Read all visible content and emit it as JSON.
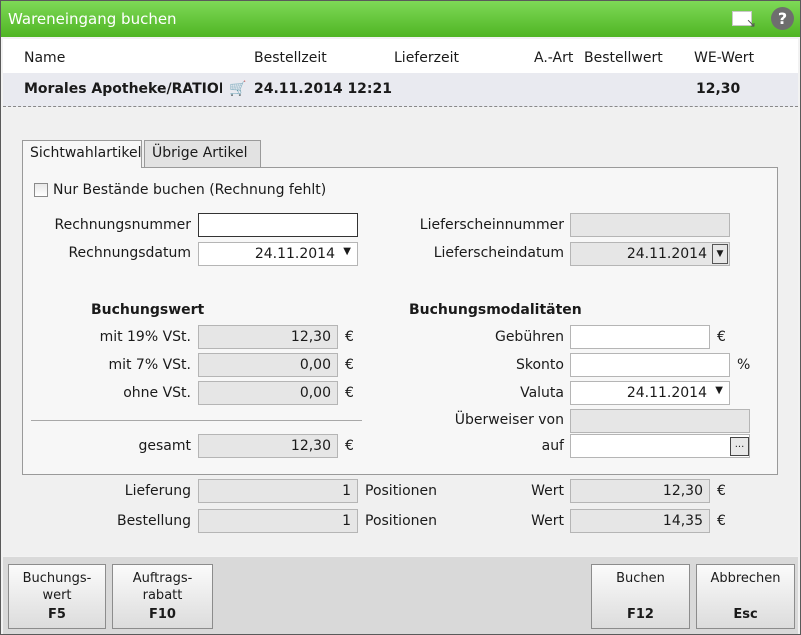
{
  "window": {
    "title": "Wareneingang buchen"
  },
  "columns": {
    "name": "Name",
    "bestellzeit": "Bestellzeit",
    "lieferzeit": "Lieferzeit",
    "aart": "A.-Art",
    "bestellwert": "Bestellwert",
    "wewert": "WE-Wert"
  },
  "order": {
    "name": "Morales Apotheke/RATIOPH",
    "bestellzeit": "24.11.2014 12:21",
    "wewert": "12,30"
  },
  "tabs": [
    "Sichtwahlartikel",
    "Übrige Artikel"
  ],
  "form": {
    "checkbox_label": "Nur Bestände buchen (Rechnung fehlt)",
    "rechnungsnummer_label": "Rechnungsnummer",
    "rechnungsnummer_value": "",
    "rechnungsdatum_label": "Rechnungsdatum",
    "rechnungsdatum_value": "24.11.2014",
    "lieferscheinnummer_label": "Lieferscheinnummer",
    "lieferscheinnummer_value": "",
    "lieferscheindatum_label": "Lieferscheindatum",
    "lieferscheindatum_value": "24.11.2014",
    "buchungswert_heading": "Buchungswert",
    "vst19_label": "mit 19% VSt.",
    "vst19_value": "12,30",
    "vst7_label": "mit 7% VSt.",
    "vst7_value": "0,00",
    "ohne_label": "ohne VSt.",
    "ohne_value": "0,00",
    "gesamt_label": "gesamt",
    "gesamt_value": "12,30",
    "currency": "€",
    "percent": "%",
    "modalitaeten_heading": "Buchungsmodalitäten",
    "gebuehren_label": "Gebühren",
    "gebuehren_value": "",
    "skonto_label": "Skonto",
    "skonto_value": "",
    "valuta_label": "Valuta",
    "valuta_value": "24.11.2014",
    "ueberweiser_label": "Überweiser von",
    "ueberweiser_value": "",
    "auf_label": "auf",
    "auf_value": "",
    "ellipsis": "..."
  },
  "summary": {
    "lieferung_label": "Lieferung",
    "lieferung_count": "1",
    "bestellung_label": "Bestellung",
    "bestellung_count": "1",
    "positionen": "Positionen",
    "wert_label": "Wert",
    "lieferung_wert": "12,30",
    "bestellung_wert": "14,35"
  },
  "footer": {
    "buchungswert": {
      "line1": "Buchungs-",
      "line2": "wert",
      "key": "F5"
    },
    "auftragsrabatt": {
      "line1": "Auftrags-",
      "line2": "rabatt",
      "key": "F10"
    },
    "buchen": {
      "line1": "Buchen",
      "key": "F12"
    },
    "abbrechen": {
      "line1": "Abbrechen",
      "key": "Esc"
    }
  },
  "colors": {
    "titlebar": "#5cc232",
    "row_highlight": "#e9eaf0",
    "footer": "#d9d9d9"
  },
  "icons": {
    "maximize": "window-restore-icon",
    "help": "help-icon",
    "cart": "shopping-cart-icon"
  }
}
